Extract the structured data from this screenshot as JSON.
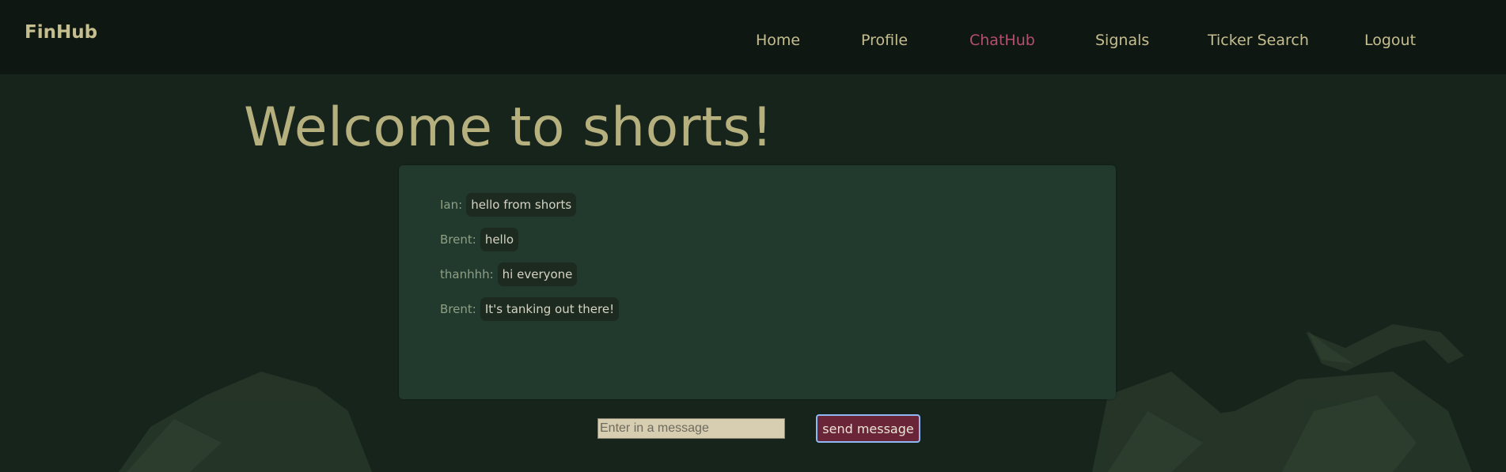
{
  "brand": "FinHub",
  "nav": {
    "items": [
      {
        "label": "Home"
      },
      {
        "label": "Profile"
      },
      {
        "label": "ChatHub"
      },
      {
        "label": "Signals"
      },
      {
        "label": "Ticker Search"
      },
      {
        "label": "Logout"
      }
    ],
    "active": "ChatHub"
  },
  "page": {
    "title": "Welcome to shorts!"
  },
  "chat": {
    "messages": [
      {
        "user": "Ian:",
        "text": "hello from shorts"
      },
      {
        "user": "Brent:",
        "text": "hello"
      },
      {
        "user": "thanhhh:",
        "text": "hi everyone"
      },
      {
        "user": "Brent:",
        "text": "It's tanking out there!"
      }
    ]
  },
  "composer": {
    "placeholder": "Enter in a message",
    "send_label": "send message"
  },
  "colors": {
    "background": "#16241c",
    "navbar": "#0f1712",
    "accent_text": "#c5be8f",
    "active_nav": "#b44f6d",
    "chat_panel": "#223a2e",
    "send_button": "#6a2638"
  }
}
